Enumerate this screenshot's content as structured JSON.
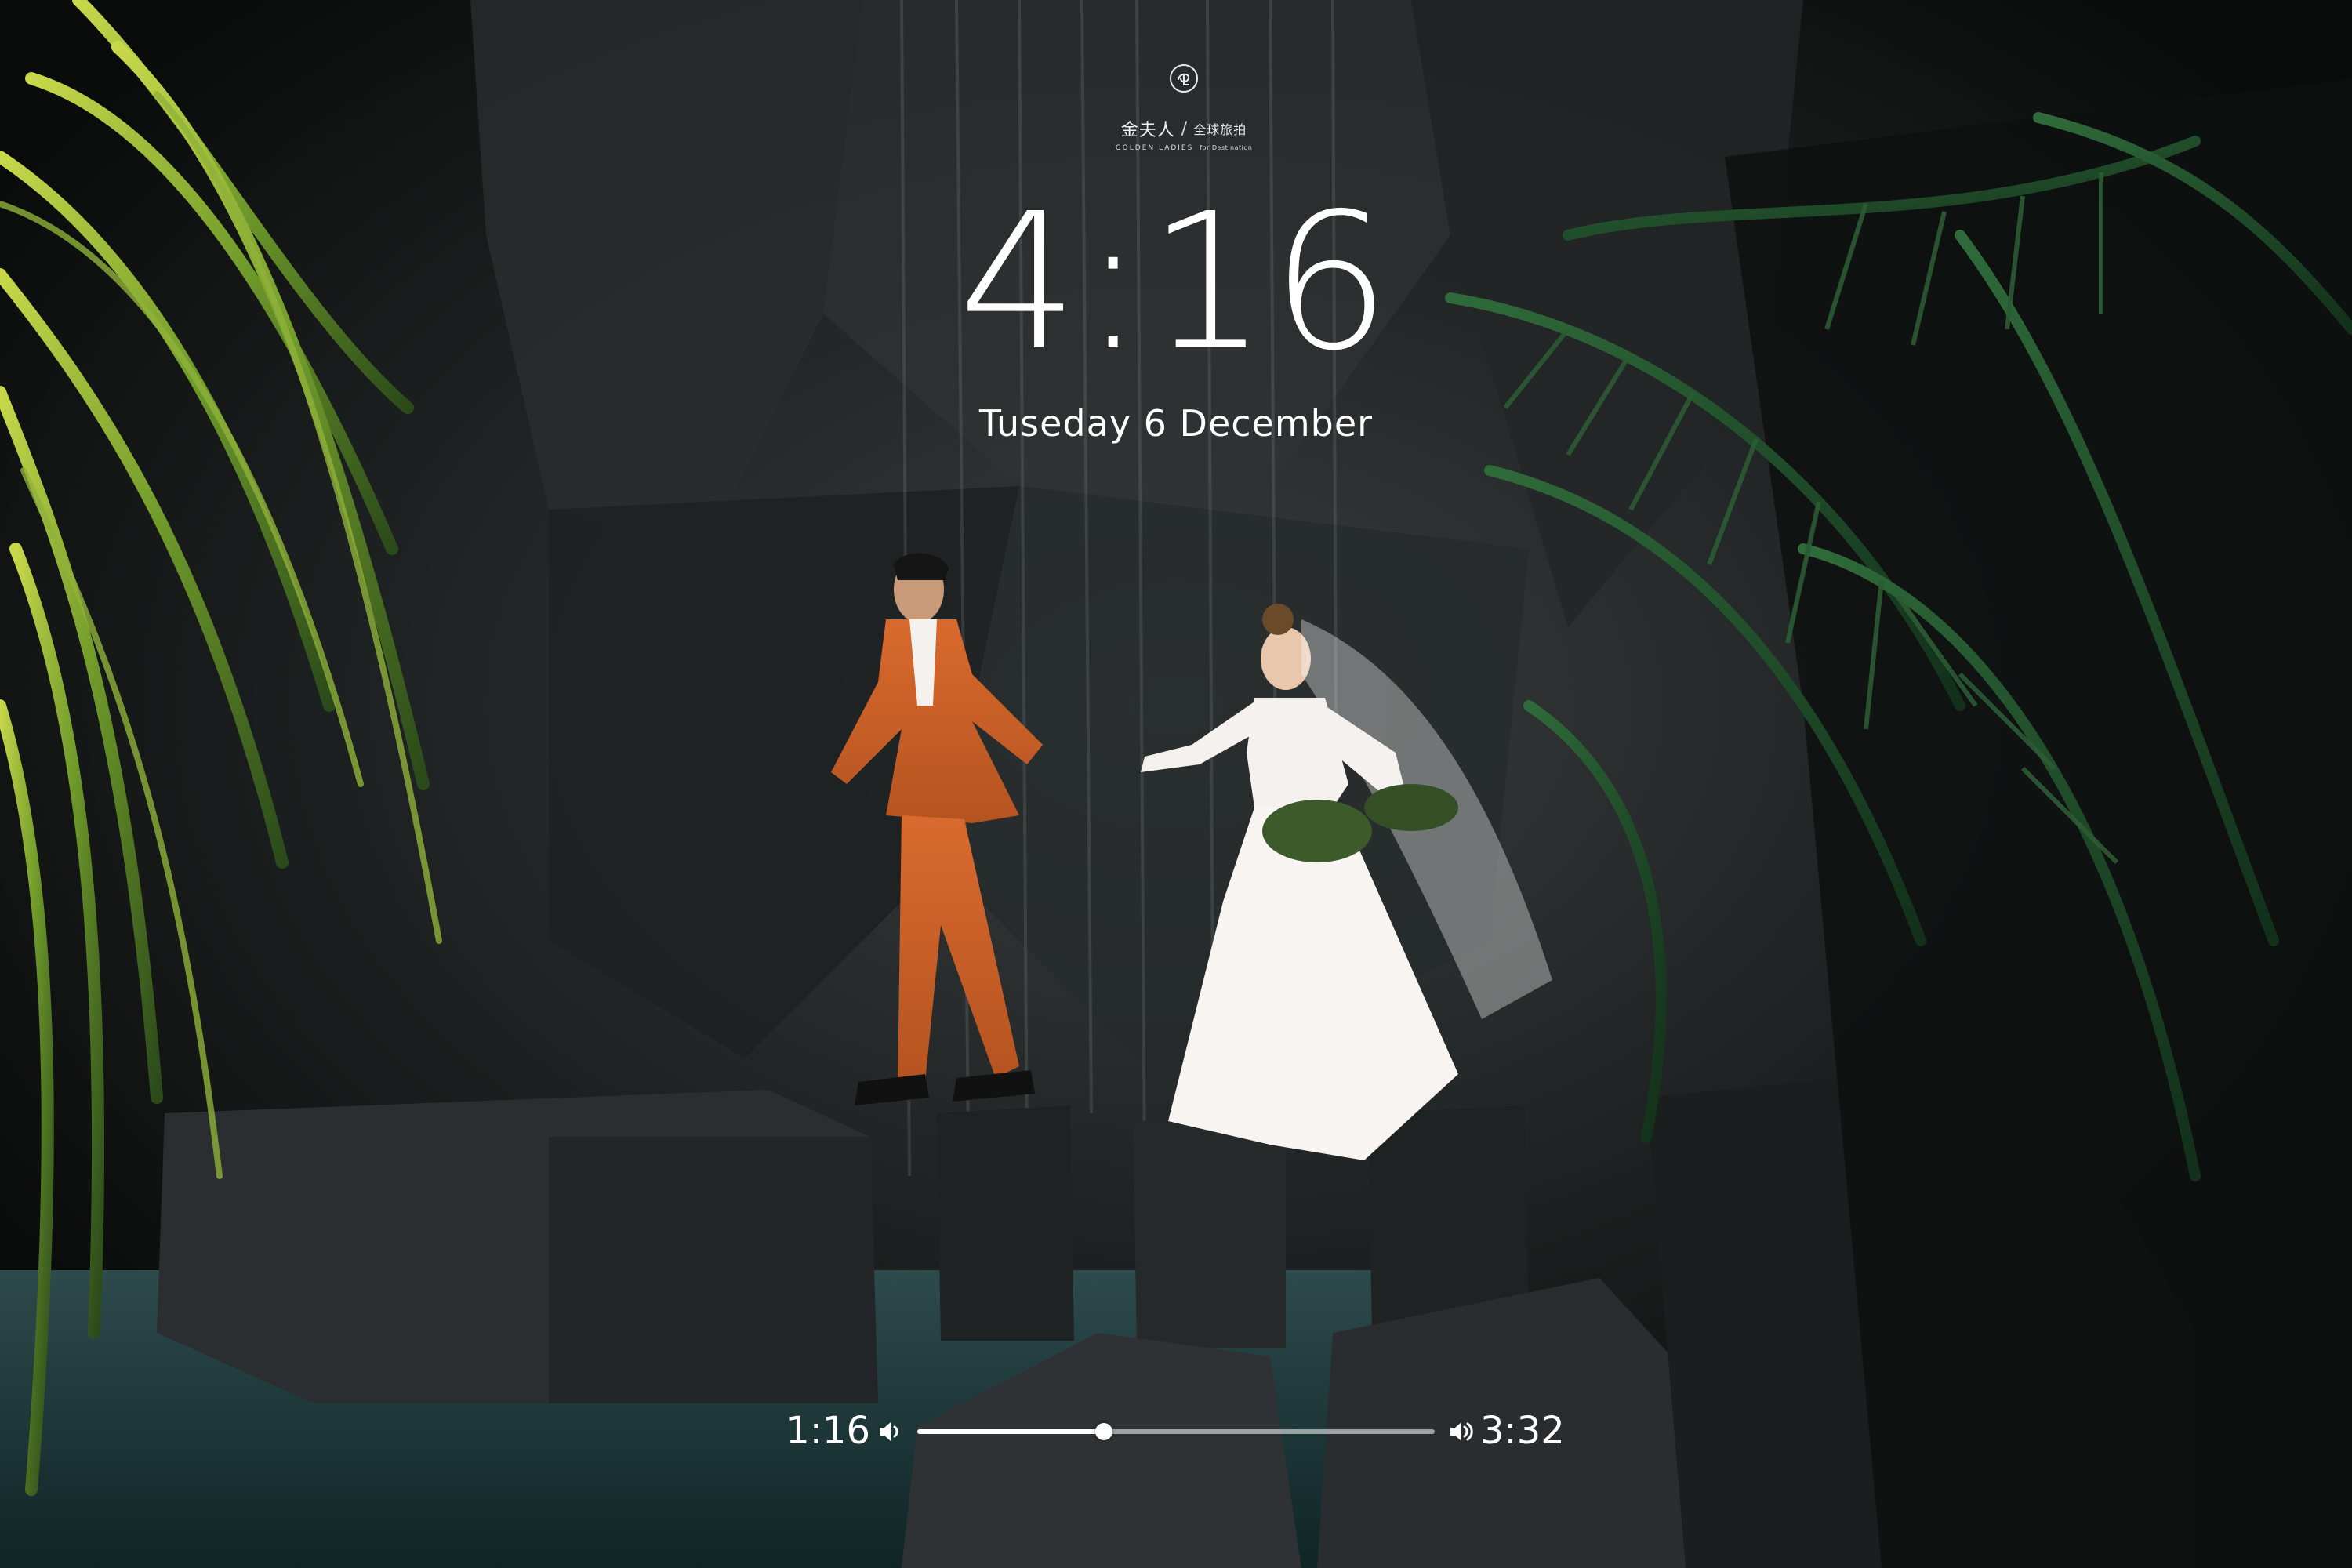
{
  "logo": {
    "brand_cn": "金夫人",
    "divider": "/",
    "tagline_cn": "全球旅拍",
    "brand_en": "GOLDEN LADIES",
    "tagline_en": "for Destination"
  },
  "lockscreen": {
    "time": "4:16",
    "date": "Tuseday 6 December"
  },
  "player": {
    "elapsed": "1:16",
    "total": "3:32",
    "progress_fraction": 0.36,
    "volume_low_icon": "speaker-low-icon",
    "volume_high_icon": "speaker-high-icon"
  },
  "colors": {
    "text": "#ffffff",
    "track": "#ffffff"
  }
}
